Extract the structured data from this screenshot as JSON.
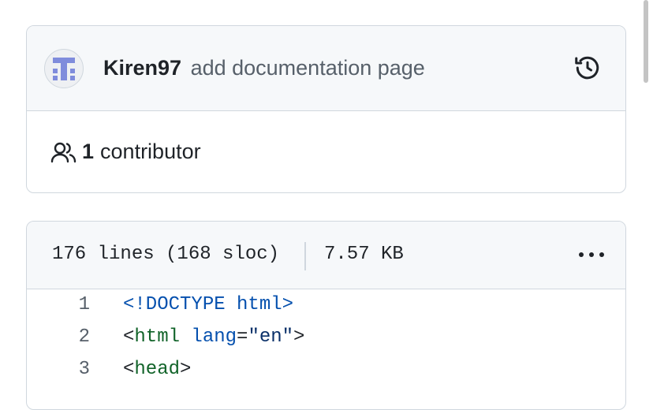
{
  "commit": {
    "author": "Kiren97",
    "message": "add documentation page"
  },
  "contributors": {
    "count": "1",
    "label": "contributor"
  },
  "file": {
    "lines_info": "176 lines (168 sloc)",
    "size": "7.57 KB"
  },
  "code": {
    "lines": [
      {
        "number": "1",
        "doctype": "<!DOCTYPE html>"
      },
      {
        "number": "2",
        "open": "<",
        "tag": "html",
        "space": " ",
        "attr": "lang",
        "eq": "=",
        "value": "\"en\"",
        "close": ">"
      },
      {
        "number": "3",
        "open": "<",
        "tag": "head",
        "close": ">"
      }
    ]
  },
  "icons": {
    "avatar": "identicon-avatar",
    "history": "history-icon",
    "people": "people-icon",
    "more": "kebab-horizontal-icon"
  },
  "colors": {
    "avatar_accent": "#7f8cdc",
    "border": "#d0d7de",
    "header_bg": "#f6f8fa"
  }
}
